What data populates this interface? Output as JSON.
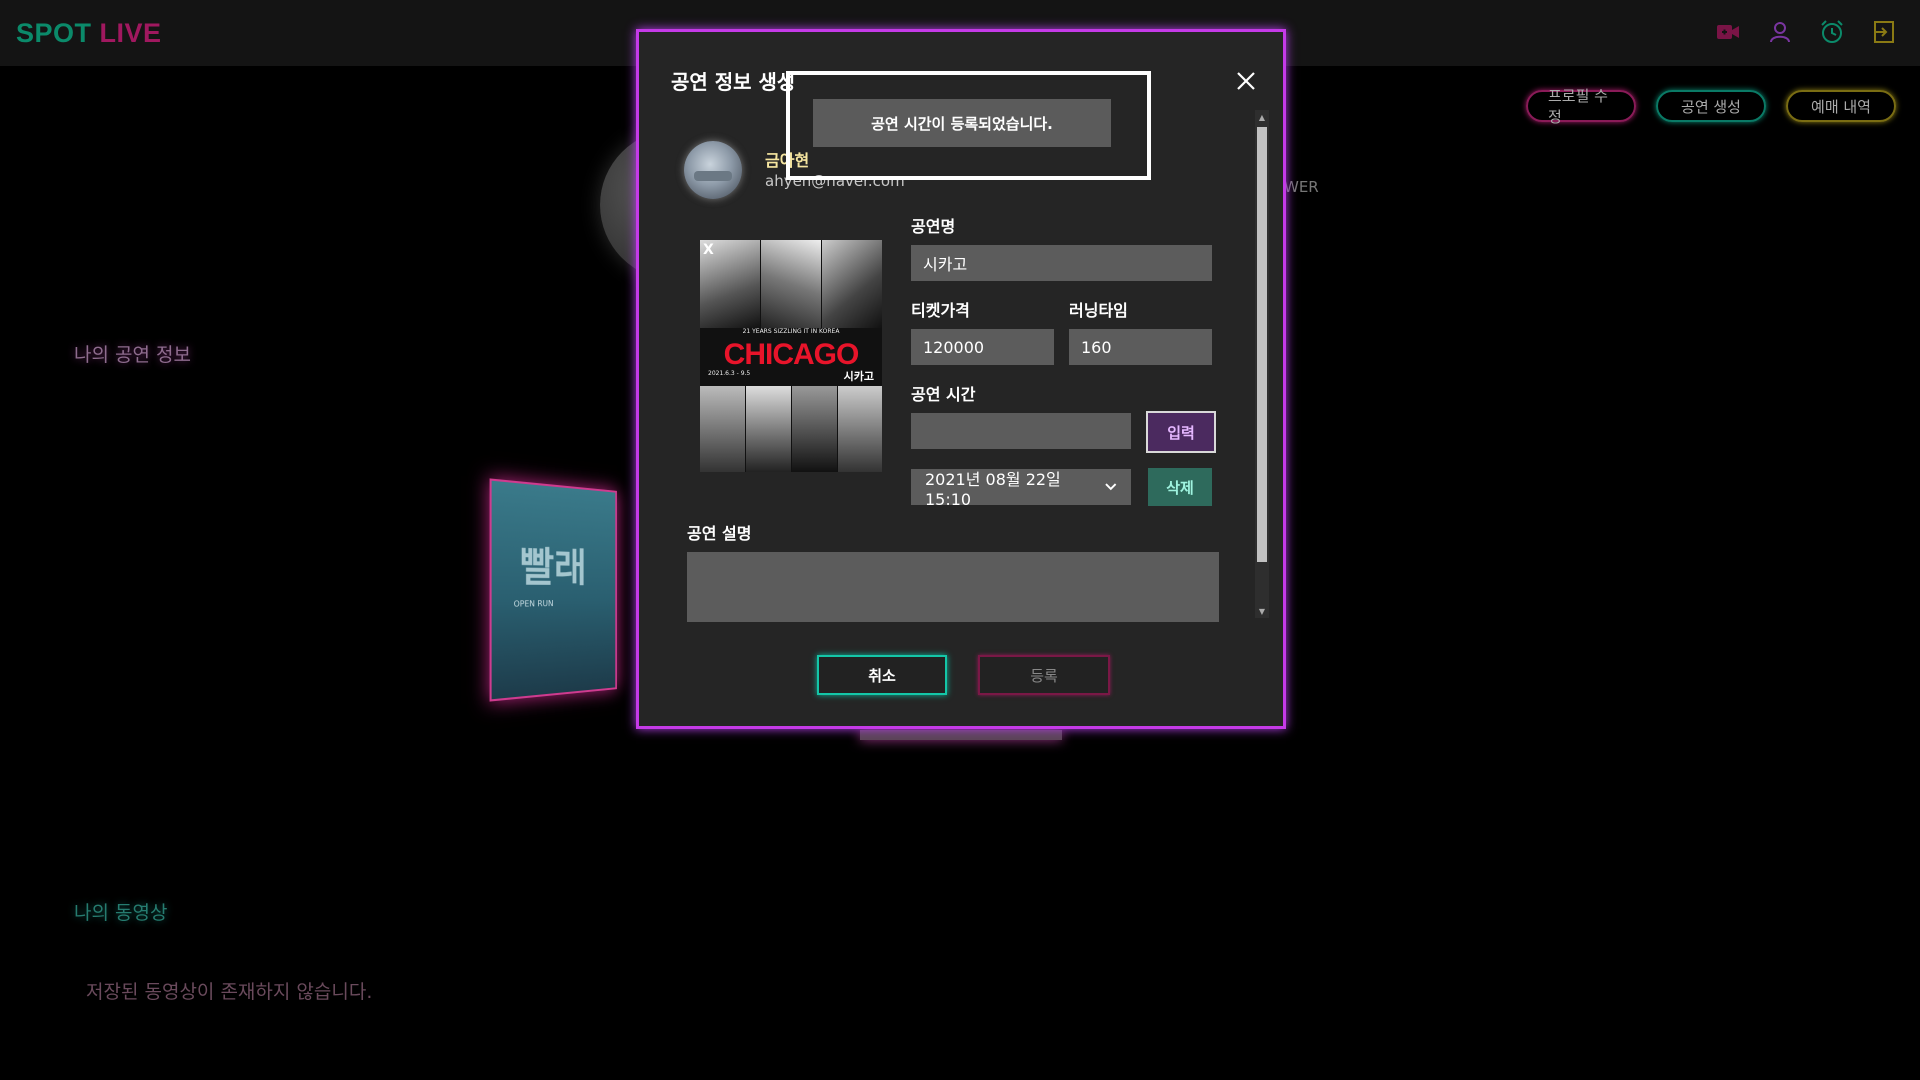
{
  "app": {
    "logo_spot": "SPOT",
    "logo_live": "LIVE"
  },
  "header_icons": [
    "video-icon",
    "user-icon",
    "alarm-icon",
    "logout-icon"
  ],
  "profile_buttons": {
    "edit": "프로필 수정",
    "create": "공연 생성",
    "reservations": "예매 내역"
  },
  "viewer_stub": "WER",
  "sections": {
    "my_performance": "나의 공연 정보",
    "my_videos": "나의 동영상",
    "no_videos": "저장된 동영상이 존재하지 않습니다."
  },
  "bg_poster": {
    "title": "빨래",
    "subtitle": "OPEN RUN"
  },
  "modal": {
    "title": "공연 정보 생성",
    "toast": "공연 시간이 등록되었습니다.",
    "user": {
      "name": "금아현",
      "email": "ahyen@naver.com"
    },
    "poster": {
      "remove_label": "X",
      "brand": "CHICAGO",
      "tagline": "21 YEARS SIZZLING IT IN KOREA",
      "dates": "2021.6.3 - 9.5",
      "korean_title": "시카고"
    },
    "fields": {
      "name_label": "공연명",
      "name_value": "시카고",
      "price_label": "티켓가격",
      "price_value": "120000",
      "runtime_label": "러닝타임",
      "runtime_value": "160",
      "time_label": "공연 시간",
      "time_input_value": "",
      "input_button": "입력",
      "selected_time": "2021년 08월 22일 15:10",
      "delete_button": "삭제",
      "description_label": "공연 설명",
      "description_value": ""
    },
    "buttons": {
      "cancel": "취소",
      "register": "등록"
    }
  },
  "colors": {
    "modal_border": "#c53ae8",
    "logo_spot": "#0b8a6a",
    "logo_live": "#a0185f",
    "cancel_border": "#14c6a8",
    "register_border": "#7a1846"
  }
}
